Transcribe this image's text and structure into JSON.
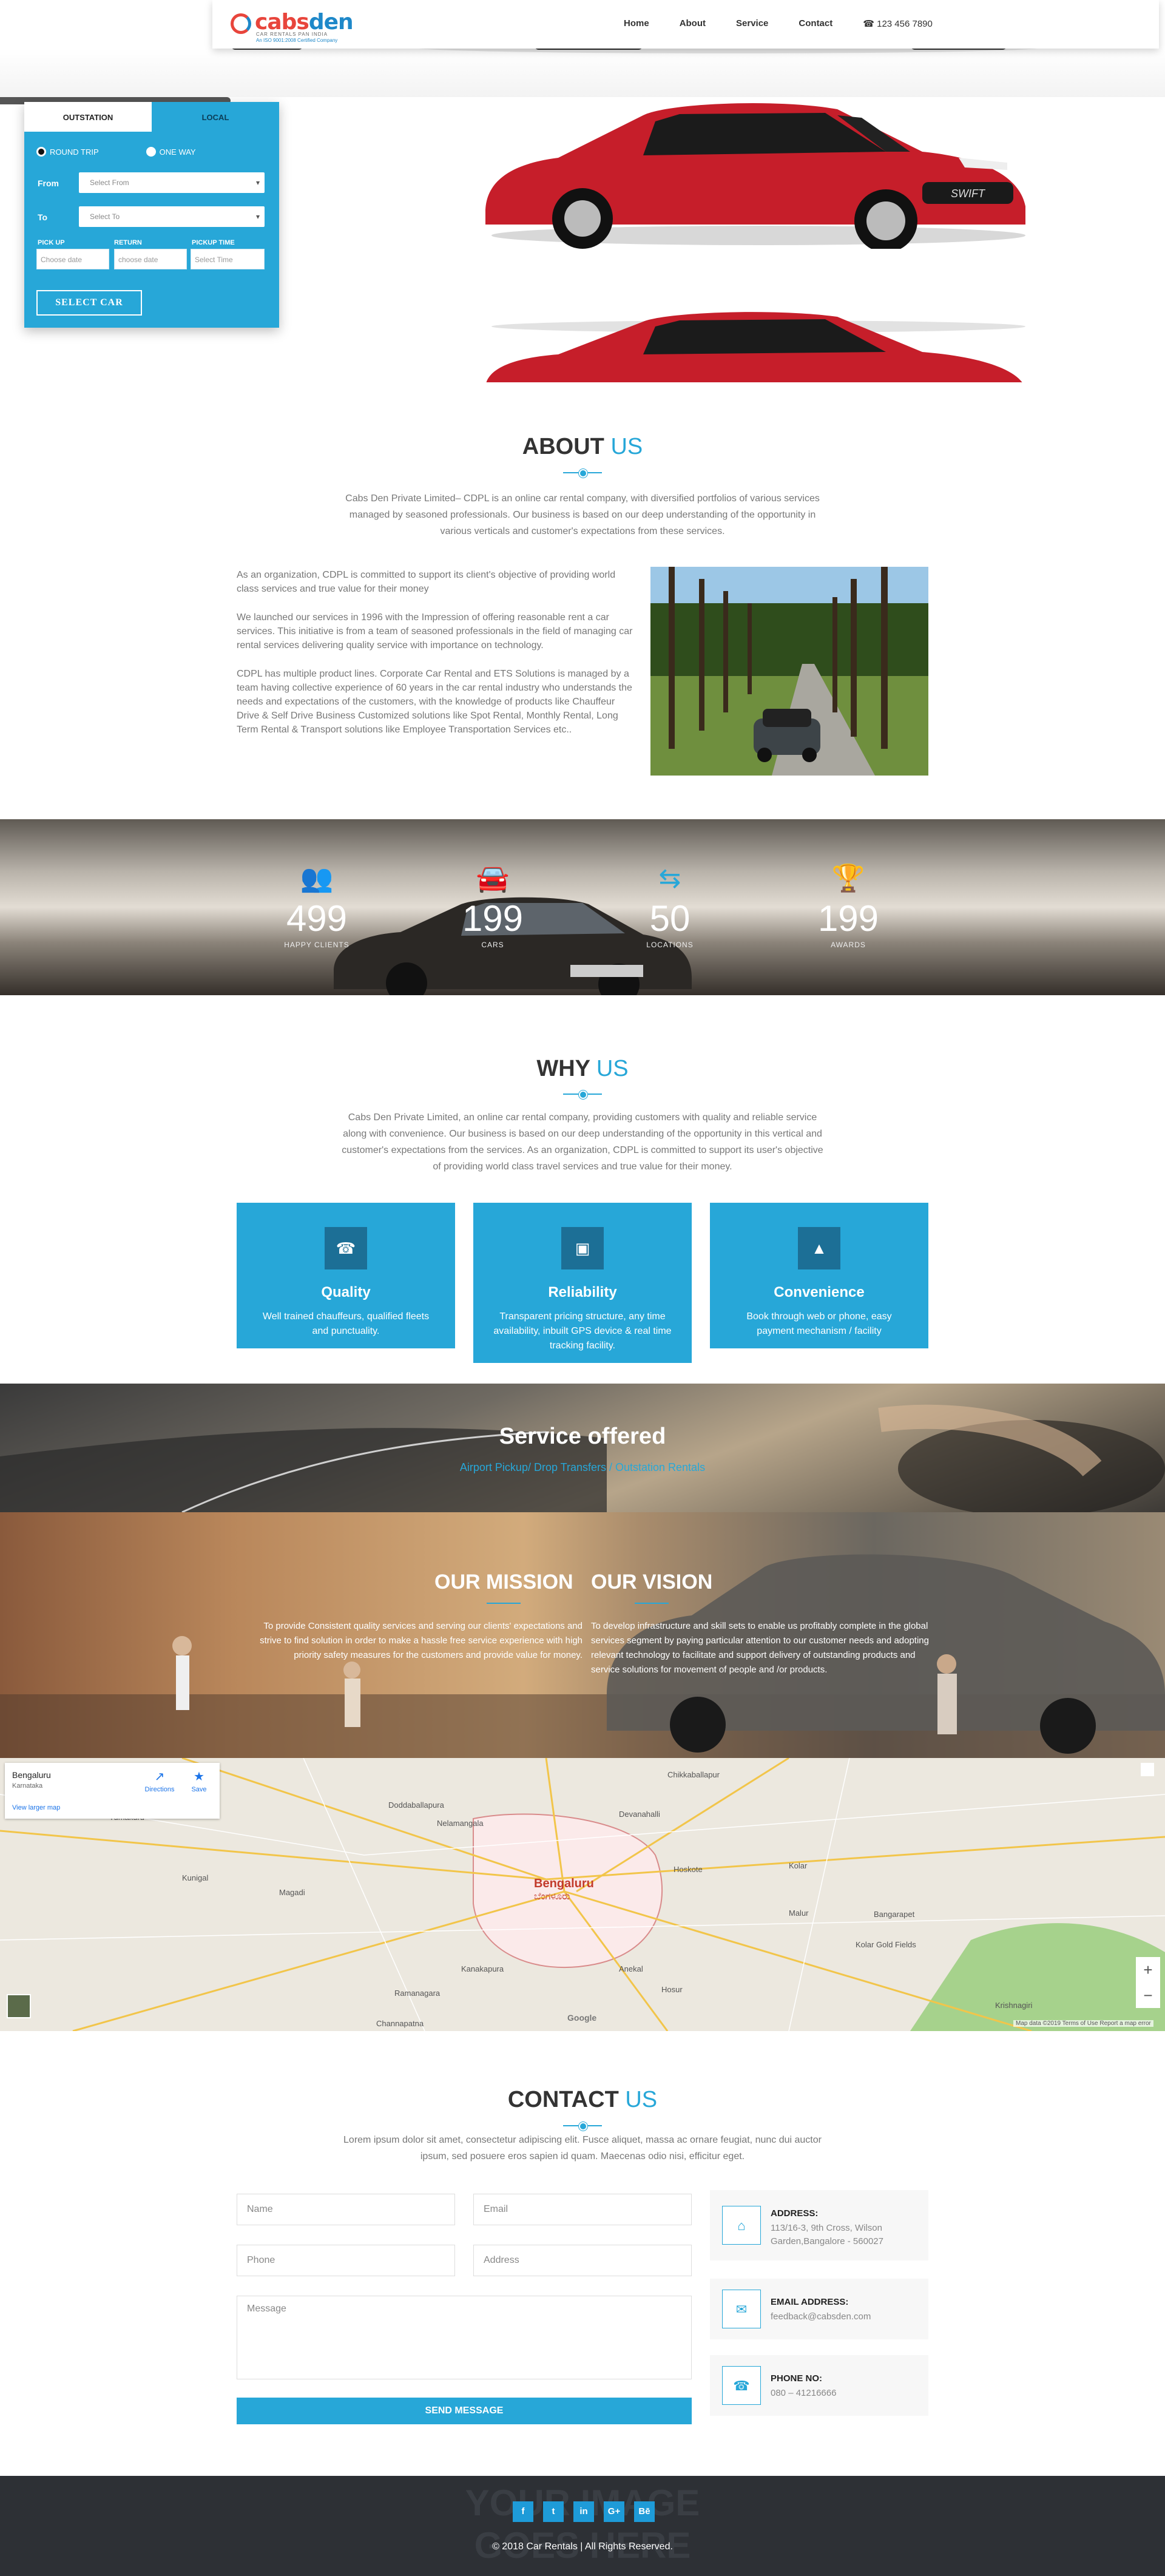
{
  "header": {
    "logo_word_a": "cabs",
    "logo_word_b": "den",
    "logo_tag1": "CAR RENTALS PAN INDIA",
    "logo_tag2": "An ISO 9001:2008 Certified Company",
    "nav": [
      "Home",
      "About",
      "Service",
      "Contact"
    ],
    "phone": "☎ 123 456 7890"
  },
  "booking": {
    "tab_outstation": "OUTSTATION",
    "tab_local": "LOCAL",
    "round_trip": "ROUND TRIP",
    "one_way": "ONE WAY",
    "from_label": "From",
    "from_placeholder": "Select From",
    "to_label": "To",
    "to_placeholder": "Select To",
    "pickup_label": "PICK UP",
    "return_label": "RETURN",
    "pickup_time_label": "PICKUP TIME",
    "pickup_placeholder": "Choose date",
    "return_placeholder": "choose date",
    "time_placeholder": "Select Time",
    "submit": "SELECT CAR"
  },
  "about": {
    "title": "ABOUT",
    "title_hl": "US",
    "intro": "Cabs Den Private Limited– CDPL is an online car rental company, with diversified portfolios of various services managed by seasoned professionals. Our business is based on our deep understanding of the opportunity in various verticals and customer's expectations from these services.",
    "p1": "As an organization, CDPL is committed to support its client's objective of providing world class services and true value for their money",
    "p2": "We launched our services in 1996 with the Impression of offering reasonable rent a car services. This initiative is from a team of seasoned professionals in the field of managing car rental services delivering quality service with importance on technology.",
    "p3": "CDPL has multiple product lines. Corporate Car Rental and ETS Solutions is managed by a team having collective experience of 60 years in the car rental industry who understands the needs and expectations of the customers, with the knowledge of products like Chauffeur Drive & Self Drive Business Customized solutions like Spot Rental, Monthly Rental, Long Term Rental & Transport solutions like Employee Transportation Services etc.."
  },
  "stats": [
    {
      "icon": "users-icon",
      "value": "499",
      "caption": "HAPPY CLIENTS"
    },
    {
      "icon": "car-icon",
      "value": "199",
      "caption": "CARS"
    },
    {
      "icon": "signpost-icon",
      "value": "50",
      "caption": "LOCATIONS"
    },
    {
      "icon": "trophy-icon",
      "value": "199",
      "caption": "AWARDS"
    }
  ],
  "why": {
    "title": "WHY",
    "title_hl": "US",
    "intro": "Cabs Den Private Limited, an online car rental company, providing customers with quality and reliable service along with convenience. Our business is based on our deep understanding of the opportunity in this vertical and customer's expectations from the services. As an organization, CDPL is committed to support its user's objective of providing world class travel services and true value for their money.",
    "cards": [
      {
        "icon": "phone-icon",
        "title": "Quality",
        "desc": "Well trained chauffeurs, qualified fleets and punctuality."
      },
      {
        "icon": "money-icon",
        "title": "Reliability",
        "desc": "Transparent pricing structure, any time availability, inbuilt GPS device & real time tracking facility."
      },
      {
        "icon": "road-icon",
        "title": "Convenience",
        "desc": "Book through web or phone, easy payment mechanism / facility"
      }
    ]
  },
  "service": {
    "title": "Service offered",
    "subtitle": "Airport Pickup/ Drop Transfers / Outstation Rentals"
  },
  "mission": {
    "mission_title": "OUR MISSION",
    "mission_text": "To provide Consistent quality services and serving our clients' expectations and strive to find solution in order to make a hassle free service experience with high priority safety measures for the customers and provide value for money.",
    "vision_title": "OUR VISION",
    "vision_text": "To develop infrastructure and skill sets to enable us profitably complete in the global services segment by paying particular attention to our customer needs and adopting relevant technology to facilitate and support delivery of outstanding products and service solutions for movement of people and /or products."
  },
  "map": {
    "place": "Bengaluru",
    "region": "Karnataka",
    "larger_link": "View larger map",
    "directions": "Directions",
    "save": "Save",
    "city_label": "Bengaluru",
    "city_label_local": "ಬೆಂಗಳೂರು",
    "towns": [
      "Doddaballapura",
      "Nelamangala",
      "Devanahalli",
      "Hoskote",
      "Kolar",
      "Kunigal",
      "Magadi",
      "Ramanagara",
      "Kanakapura",
      "Hosur",
      "Anekal",
      "Bangarapet",
      "Kolar Gold Fields",
      "Malur",
      "Chikkaballapur",
      "Tumakuru",
      "Channapatna",
      "Krishnagiri"
    ],
    "attribution": "Map data ©2019   Terms of Use   Report a map error",
    "google": "Google",
    "zoom_in": "+",
    "zoom_out": "−"
  },
  "contact": {
    "title": "CONTACT",
    "title_hl": "US",
    "intro": "Lorem ipsum dolor sit amet, consectetur adipiscing elit. Fusce aliquet, massa ac ornare feugiat, nunc dui auctor ipsum, sed posuere eros sapien id quam. Maecenas odio nisi, efficitur eget.",
    "ph_name": "Name",
    "ph_email": "Email",
    "ph_phone": "Phone",
    "ph_address": "Address",
    "ph_message": "Message",
    "send": "SEND MESSAGE",
    "address_h": "ADDRESS:",
    "address_v1": "113/16-3, 9th Cross, Wilson",
    "address_v2": "Garden,Bangalore - 560027",
    "email_h": "EMAIL ADDRESS:",
    "email_v": "feedback@cabsden.com",
    "phone_h": "PHONE NO:",
    "phone_v": "080 – 41216666"
  },
  "footer": {
    "ghost1": "YOUR IMAGE",
    "ghost2": "GOES HERE",
    "socials": [
      "f",
      "t",
      "in",
      "G+",
      "Bē"
    ],
    "copyright": "© 2018 Car Rentals | All Rights Reserved."
  },
  "colors": {
    "accent": "#27a7d8",
    "logo_red": "#e8453c",
    "footer_bg": "#2d3035"
  }
}
